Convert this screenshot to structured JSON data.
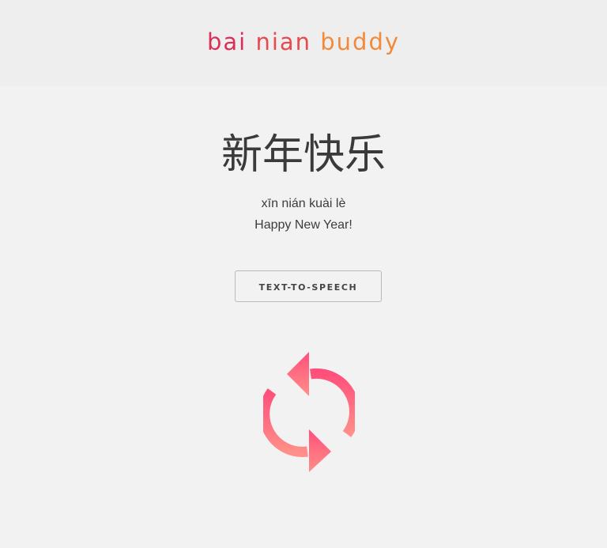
{
  "header": {
    "brand_words": [
      "bai",
      "nian",
      "buddy"
    ]
  },
  "phrase": {
    "hanzi": "新年快乐",
    "pinyin": "xīn nián kuài lè",
    "translation": "Happy New Year!"
  },
  "actions": {
    "tts_label": "TEXT-TO-SPEECH",
    "refresh_icon": "refresh-icon"
  },
  "colors": {
    "brand_start": "#dd2e57",
    "brand_end": "#f28a3c",
    "icon_top": "#ff4f7b",
    "icon_bottom": "#ff8f88",
    "background": "#f2f2f2",
    "header_background": "#eeeeee"
  }
}
